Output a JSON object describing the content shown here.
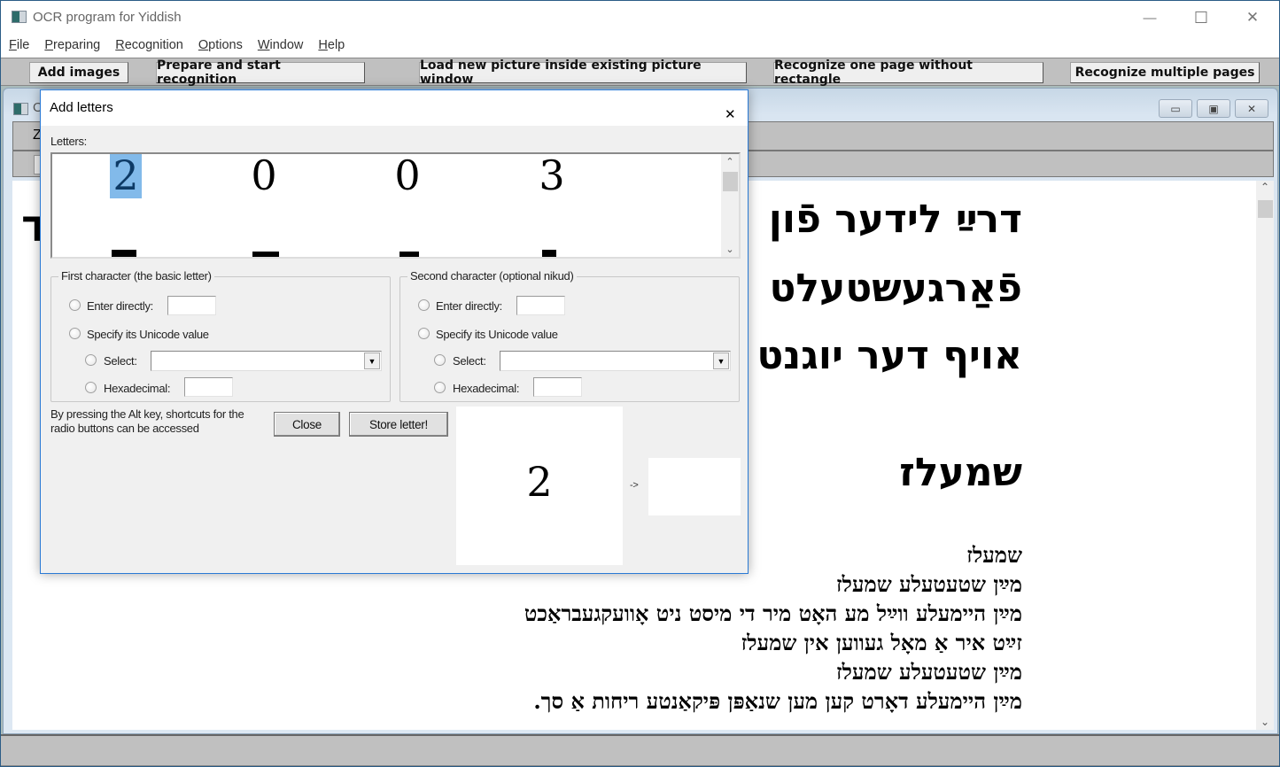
{
  "window": {
    "title": "OCR program for Yiddish",
    "controls": {
      "minimize": "—",
      "maximize": "☐",
      "close": "✕"
    }
  },
  "menu": [
    {
      "label": "File",
      "accel": "F",
      "rest": "ile"
    },
    {
      "label": "Preparing",
      "accel": "P",
      "rest": "reparing"
    },
    {
      "label": "Recognition",
      "accel": "R",
      "rest": "ecognition"
    },
    {
      "label": "Options",
      "accel": "O",
      "rest": "ptions"
    },
    {
      "label": "Window",
      "accel": "W",
      "rest": "indow"
    },
    {
      "label": "Help",
      "accel": "H",
      "rest": "elp"
    }
  ],
  "toolbar": {
    "add_images": "Add images",
    "prepare_start": "Prepare and start recognition",
    "load_new_picture": "Load new picture inside existing picture window",
    "recognize_one_page": "Recognize one page without rectangle",
    "recognize_multiple": "Recognize multiple pages"
  },
  "child_window": {
    "partial_title": "O",
    "strip_label": "Z",
    "controls": {
      "minimize": "▭",
      "restore": "▣",
      "close": "✕"
    },
    "document": {
      "big_lines": [
        "דרײַ לידער פֿון",
        "פֿאַרגעשטעלט",
        "אויף דער יוגנט"
      ],
      "left_edge_glyph": "ד",
      "heading": "שמעלז",
      "small_lines": [
        "שמעלז",
        "מײַן שטעטעלע שמעלז",
        "מײַן היימעלע ווײַל מע האָט מיר די מיסט ניט אָוועקגעבראַכט",
        "זײַט איר אַ מאָל געווען אין שמעלז",
        "מײַן שטעטעלע שמעלז",
        "מײַן היימעלע דאָרט קען מען שנאַפּן פּיקאַנטע ריחות אַ סך."
      ]
    }
  },
  "dialog": {
    "title": "Add letters",
    "letters_label": "Letters:",
    "letters_row1": [
      "2",
      "0",
      "0",
      "3"
    ],
    "selected_index": 0,
    "first_group": {
      "title": "First character (the basic letter)",
      "enter_directly": "Enter directly:",
      "enter_value": "",
      "specify_unicode": "Specify its Unicode value",
      "select": "Select:",
      "select_value": "",
      "hexadecimal": "Hexadecimal:",
      "hex_value": ""
    },
    "second_group": {
      "title": "Second character (optional nikud)",
      "enter_directly": "Enter directly:",
      "enter_value": "",
      "specify_unicode": "Specify its Unicode value",
      "select": "Select:",
      "select_value": "",
      "hexadecimal": "Hexadecimal:",
      "hex_value": ""
    },
    "hint": "By pressing the Alt key, shortcuts for the radio buttons can be accessed",
    "close_label": "Close",
    "store_label": "Store letter!",
    "preview_glyph": "2",
    "arrow": "->"
  }
}
